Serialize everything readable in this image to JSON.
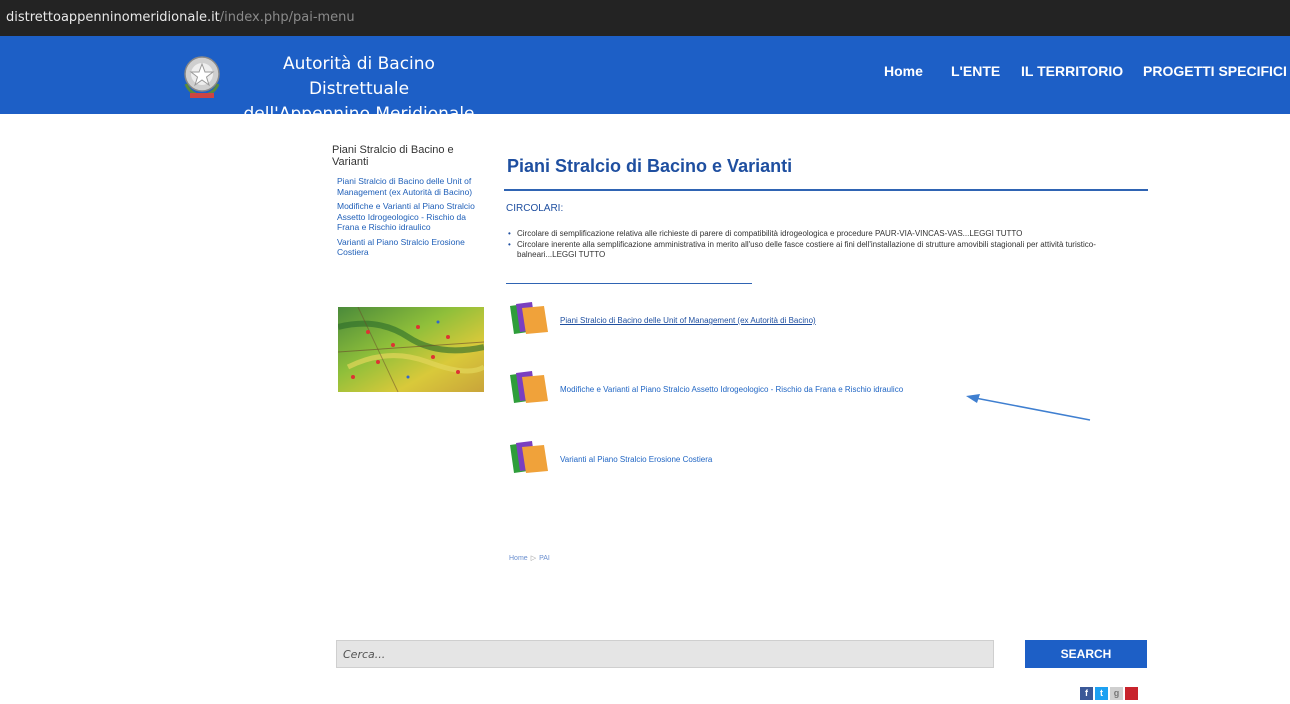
{
  "browser": {
    "url_domain": "distrettoappenninomeridionale.it",
    "url_path": "/index.php/pai-menu"
  },
  "header": {
    "title_line1": "Autorità di Bacino Distrettuale",
    "title_line2": "dell'Appennino Meridionale",
    "nav": [
      "Home",
      "L'ENTE",
      "IL TERRITORIO",
      "PROGETTI SPECIFICI"
    ],
    "color": "#1d5fc6"
  },
  "sidebar": {
    "title": "Piani Stralcio di Bacino e Varianti",
    "links": [
      "Piani Stralcio di Bacino delle Unit of Management (ex Autorità di Bacino)",
      "Modifiche e Varianti al Piano Stralcio Assetto Idrogeologico - Rischio da Frana e Rischio idraulico",
      "Varianti al Piano Stralcio Erosione Costiera"
    ]
  },
  "main": {
    "title": "Piani Stralcio di Bacino e Varianti",
    "section_label": "CIRCOLARI:",
    "circolari": [
      "Circolare di semplificazione relativa alle richieste di parere di compatibilità idrogeologica e procedure PAUR-VIA-VINCAS-VAS...LEGGI TUTTO",
      "Circolare inerente alla semplificazione amministrativa in merito all'uso delle fasce costiere ai fini dell'installazione di strutture amovibili stagionali per attività turistico-balneari...LEGGI TUTTO"
    ],
    "plans": [
      "Piani Stralcio di Bacino delle Unit of Management (ex Autorità di Bacino)",
      "Modifiche e Varianti al Piano Stralcio Assetto Idrogeologico - Rischio da Frana e Rischio idraulico",
      "Varianti al Piano Stralcio Erosione Costiera"
    ]
  },
  "breadcrumb": {
    "home": "Home",
    "current": "PAI"
  },
  "search": {
    "placeholder": "Cerca...",
    "button": "SEARCH"
  },
  "social": [
    "f",
    "t",
    "g",
    "p"
  ]
}
